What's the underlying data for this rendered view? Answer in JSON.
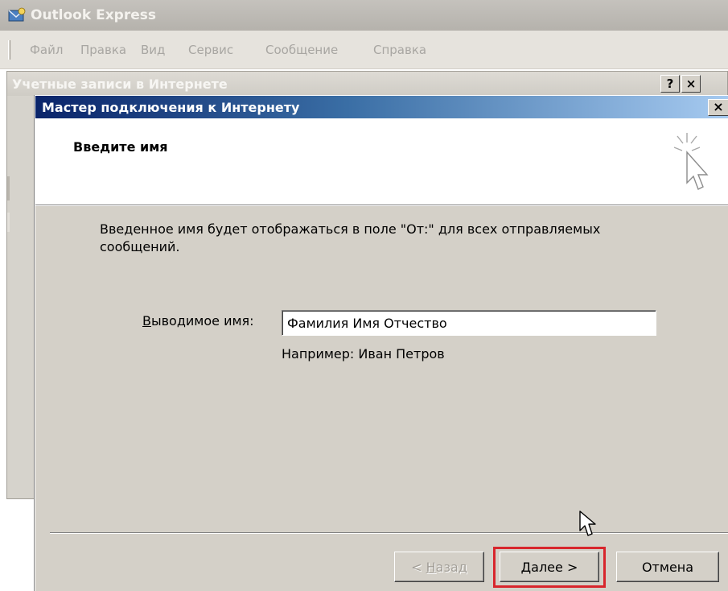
{
  "main_window": {
    "title": "Outlook Express",
    "menu": [
      "Файл",
      "Правка",
      "Вид",
      "Сервис",
      "Сообщение",
      "Справка"
    ]
  },
  "accounts_dialog": {
    "title": "Учетные записи в Интернете",
    "help_label": "?",
    "close_label": "×"
  },
  "wizard": {
    "title": "Мастер подключения к Интернету",
    "close_label": "×",
    "heading": "Введите имя",
    "description": "Введенное имя будет отображаться в поле \"От:\" для всех отправляемых сообщений.",
    "display_name_label_mnemonic": "В",
    "display_name_label_rest": "ыводимое имя:",
    "display_name_value": "Фамилия Имя Отчество",
    "example": "Например: Иван Петров",
    "buttons": {
      "back_prefix": "< ",
      "back_mnemonic": "Н",
      "back_rest": "азад",
      "next_mnemonic": "Д",
      "next_rest": "алее >",
      "cancel": "Отмена"
    }
  },
  "colors": {
    "highlight": "#d8262d",
    "title_active": "#0a246a"
  },
  "icons": [
    "outlook-express-icon",
    "wizard-cursor-icon",
    "mouse-pointer-icon"
  ]
}
